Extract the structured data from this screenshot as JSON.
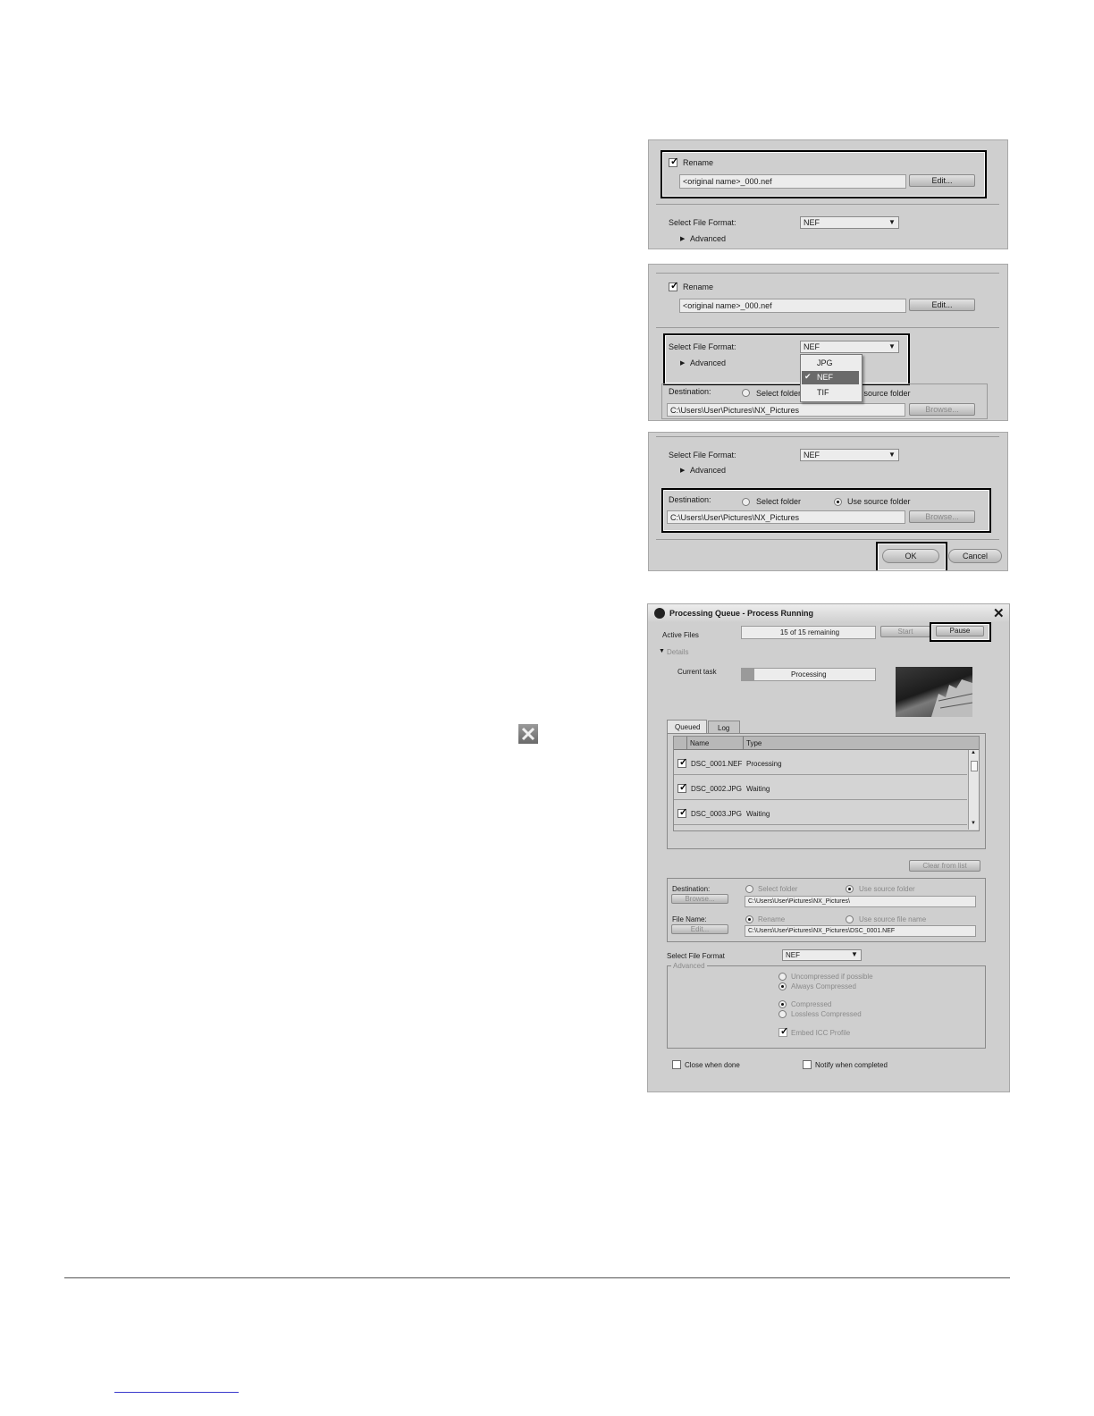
{
  "export_panel": {
    "rename_label": "Rename",
    "rename_value": "<original name>_000.nef",
    "edit_label": "Edit...",
    "format_label": "Select File Format:",
    "format_value": "NEF",
    "advanced_label": "Advanced",
    "format_options": [
      "JPG",
      "NEF",
      "TIF"
    ],
    "destination_label": "Destination:",
    "select_folder_label": "Select folder",
    "use_source_label": "Use source folder",
    "dest_path": "C:\\Users\\User\\Pictures\\NX_Pictures",
    "browse_label": "Browse...",
    "ok_label": "OK",
    "cancel_label": "Cancel"
  },
  "queue": {
    "title": "Processing Queue - Process Running",
    "active_files_label": "Active Files",
    "remaining_text": "15 of 15 remaining",
    "start_label": "Start",
    "pause_label": "Pause",
    "details_label": "Details",
    "current_task_label": "Current task",
    "processing_text": "Processing",
    "tabs": [
      "Queued",
      "Log"
    ],
    "col_name": "Name",
    "col_type": "Type",
    "rows": [
      {
        "name": "DSC_0001.NEF",
        "type": "Processing"
      },
      {
        "name": "DSC_0002.JPG",
        "type": "Waiting"
      },
      {
        "name": "DSC_0003.JPG",
        "type": "Waiting"
      }
    ],
    "clear_label": "Clear from list",
    "destination_label": "Destination:",
    "browse_label": "Browse...",
    "select_folder_label": "Select folder",
    "use_source_label": "Use source folder",
    "dest_path": "C:\\Users\\User\\Pictures\\NX_Pictures\\",
    "file_name_label": "File Name:",
    "edit_label": "Edit...",
    "rename_label": "Rename",
    "use_source_name_label": "Use source file name",
    "file_path": "C:\\Users\\User\\Pictures\\NX_Pictures\\DSC_0001.NEF",
    "format_label": "Select File Format",
    "format_value": "NEF",
    "advanced_label": "Advanced",
    "opt_uncompressed": "Uncompressed if possible",
    "opt_always": "Always Compressed",
    "opt_compressed": "Compressed",
    "opt_lossless": "Lossless Compressed",
    "opt_embed": "Embed ICC Profile",
    "close_when_done": "Close when done",
    "notify_label": "Notify when completed"
  }
}
